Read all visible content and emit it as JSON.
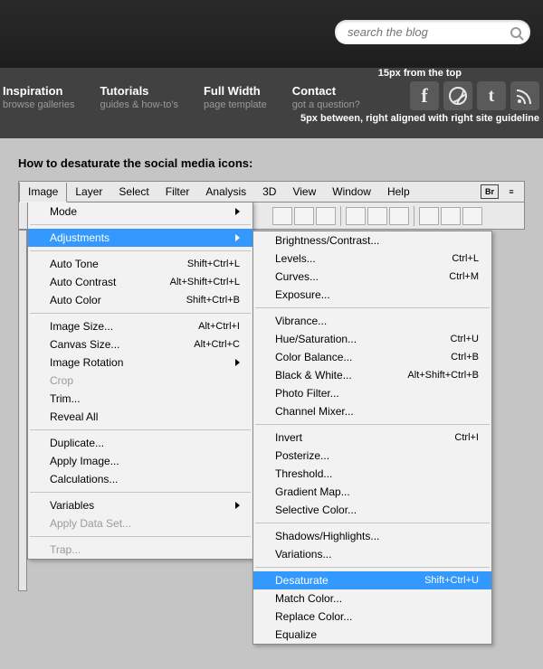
{
  "search": {
    "placeholder": "search the blog"
  },
  "nav": [
    {
      "title": "Inspiration",
      "sub": "browse galleries"
    },
    {
      "title": "Tutorials",
      "sub": "guides & how-to's"
    },
    {
      "title": "Full Width",
      "sub": "page template"
    },
    {
      "title": "Contact",
      "sub": "got a question?"
    }
  ],
  "annot": {
    "top": "15px from the top",
    "bottom": "5px between, right aligned with right site guideline"
  },
  "caption": "How to desaturate the social media icons:",
  "menubar": {
    "items": [
      "Image",
      "Layer",
      "Select",
      "Filter",
      "Analysis",
      "3D",
      "View",
      "Window",
      "Help"
    ],
    "br": "Br"
  },
  "menu1": [
    {
      "label": "Mode",
      "sub": true
    },
    {
      "sep": true
    },
    {
      "label": "Adjustments",
      "sub": true,
      "hl": true
    },
    {
      "sep": true
    },
    {
      "label": "Auto Tone",
      "sc": "Shift+Ctrl+L"
    },
    {
      "label": "Auto Contrast",
      "sc": "Alt+Shift+Ctrl+L"
    },
    {
      "label": "Auto Color",
      "sc": "Shift+Ctrl+B"
    },
    {
      "sep": true
    },
    {
      "label": "Image Size...",
      "sc": "Alt+Ctrl+I"
    },
    {
      "label": "Canvas Size...",
      "sc": "Alt+Ctrl+C"
    },
    {
      "label": "Image Rotation",
      "sub": true
    },
    {
      "label": "Crop",
      "dis": true
    },
    {
      "label": "Trim..."
    },
    {
      "label": "Reveal All"
    },
    {
      "sep": true
    },
    {
      "label": "Duplicate..."
    },
    {
      "label": "Apply Image..."
    },
    {
      "label": "Calculations..."
    },
    {
      "sep": true
    },
    {
      "label": "Variables",
      "sub": true
    },
    {
      "label": "Apply Data Set...",
      "dis": true
    },
    {
      "sep": true
    },
    {
      "label": "Trap...",
      "dis": true
    }
  ],
  "menu2": [
    {
      "label": "Brightness/Contrast..."
    },
    {
      "label": "Levels...",
      "sc": "Ctrl+L"
    },
    {
      "label": "Curves...",
      "sc": "Ctrl+M"
    },
    {
      "label": "Exposure..."
    },
    {
      "sep": true
    },
    {
      "label": "Vibrance..."
    },
    {
      "label": "Hue/Saturation...",
      "sc": "Ctrl+U"
    },
    {
      "label": "Color Balance...",
      "sc": "Ctrl+B"
    },
    {
      "label": "Black & White...",
      "sc": "Alt+Shift+Ctrl+B"
    },
    {
      "label": "Photo Filter..."
    },
    {
      "label": "Channel Mixer..."
    },
    {
      "sep": true
    },
    {
      "label": "Invert",
      "sc": "Ctrl+I"
    },
    {
      "label": "Posterize..."
    },
    {
      "label": "Threshold..."
    },
    {
      "label": "Gradient Map..."
    },
    {
      "label": "Selective Color..."
    },
    {
      "sep": true
    },
    {
      "label": "Shadows/Highlights..."
    },
    {
      "label": "Variations..."
    },
    {
      "sep": true
    },
    {
      "label": "Desaturate",
      "sc": "Shift+Ctrl+U",
      "hl": true
    },
    {
      "label": "Match Color..."
    },
    {
      "label": "Replace Color..."
    },
    {
      "label": "Equalize"
    }
  ]
}
